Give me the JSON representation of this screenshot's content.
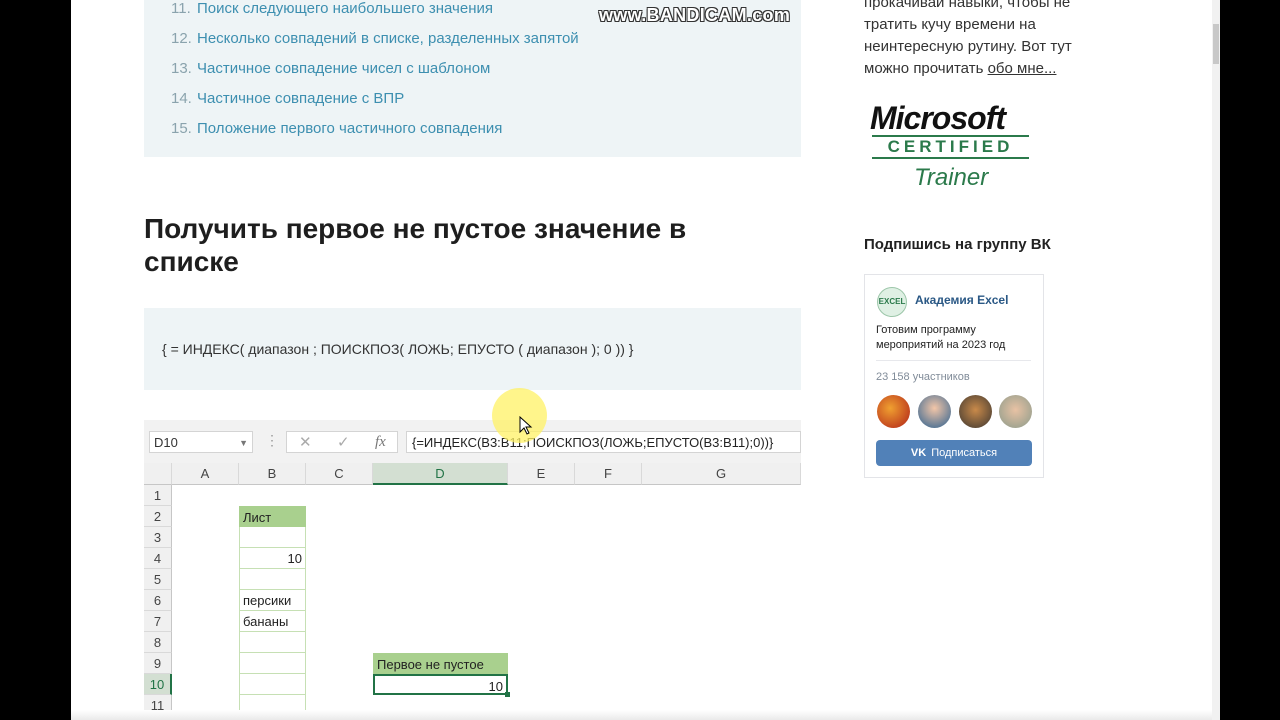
{
  "toc": [
    {
      "num": "11.",
      "label": "Поиск следующего наибольшего значения"
    },
    {
      "num": "12.",
      "label": "Несколько совпадений в списке, разделенных запятой"
    },
    {
      "num": "13.",
      "label": "Частичное совпадение чисел с шаблоном"
    },
    {
      "num": "14.",
      "label": "Частичное совпадение с ВПР"
    },
    {
      "num": "15.",
      "label": "Положение первого частичного совпадения"
    }
  ],
  "watermark": "www.BANDICAM.com",
  "section_title": "Получить первое не пустое значение в списке",
  "formula": "{ = ИНДЕКС( диапазон ; ПОИСКПОЗ( ЛОЖЬ; ЕПУСТО ( диапазон ); 0 )) }",
  "excel": {
    "name_box": "D10",
    "formula_bar": "{=ИНДЕКС(B3:B11;ПОИСКПОЗ(ЛОЖЬ;ЕПУСТО(B3:B11);0))}",
    "fx": "fx",
    "columns": [
      "A",
      "B",
      "C",
      "D",
      "E",
      "F",
      "G"
    ],
    "rows": [
      "1",
      "2",
      "3",
      "4",
      "5",
      "6",
      "7",
      "8",
      "9",
      "10",
      "11"
    ],
    "cells": {
      "b2": "Лист",
      "b4": "10",
      "b6": "персики",
      "b7": "бананы",
      "d9": "Первое не пустое",
      "d10": "10"
    }
  },
  "sidebar": {
    "about_lines": [
      "прокачивай навыки, чтобы не",
      "тратить кучу времени на",
      "неинтересную рутину. Вот тут",
      "можно прочитать "
    ],
    "about_link": "обо мне...",
    "cert": {
      "word": "Microsoft",
      "certified": "CERTIFIED",
      "trainer": "Trainer"
    },
    "vk_title": "Подпишись на группу ВК",
    "vk": {
      "avatar_text": "EXCEL",
      "group_name": "Академия Excel",
      "description": "Готовим программу мероприятий на 2023 год",
      "members": "23 158 участников",
      "subscribe": "Подписаться",
      "vk_logo": "VK"
    }
  },
  "colors": {
    "toc_link": "#3d8fb0",
    "excel_green": "#217346",
    "header_fill": "#a9d08e",
    "vk_button": "#5181b8"
  },
  "icons": [
    "cancel-icon",
    "enter-icon",
    "fx-icon",
    "arrow-up-icon",
    "mouse-cursor-icon"
  ]
}
